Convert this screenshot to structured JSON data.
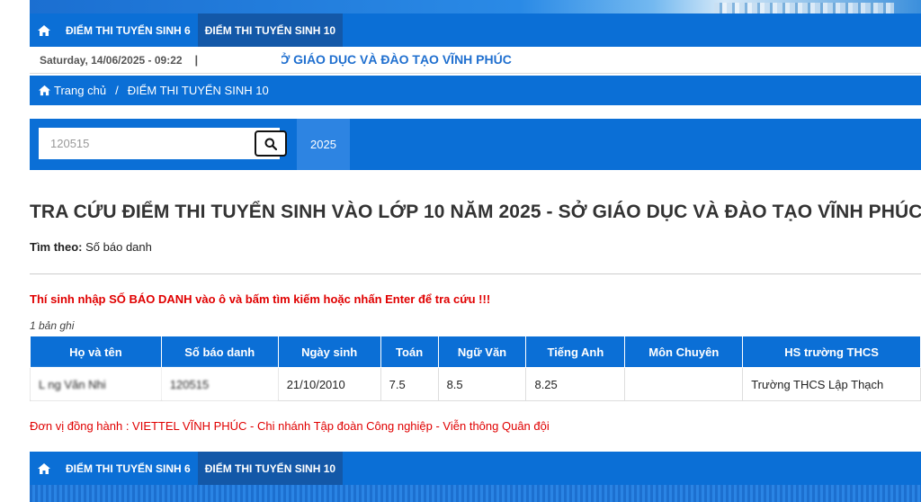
{
  "nav": {
    "home_icon": "home-icon",
    "items": [
      {
        "label": "ĐIỂM THI TUYỂN SINH 6"
      },
      {
        "label": "ĐIỂM THI TUYỂN SINH 10"
      }
    ]
  },
  "infobar": {
    "datetime": "Saturday, 14/06/2025 - 09:22",
    "separator": "|",
    "marquee": "SỞ GIÁO DỤC VÀ ĐÀO TẠO VĨNH PHÚC"
  },
  "breadcrumb": {
    "home_label": "Trang chủ",
    "separator": "/",
    "current": "ĐIỂM THI TUYỂN SINH 10"
  },
  "search": {
    "value": "120515",
    "button_icon": "search-icon",
    "year_tab": "2025"
  },
  "main": {
    "title": "TRA CỨU ĐIỂM THI TUYỂN SINH VÀO LỚP 10 NĂM 2025 - SỞ GIÁO DỤC VÀ ĐÀO TẠO VĨNH PHÚC",
    "search_by_label": "Tìm theo:",
    "search_by_value": "Số báo danh",
    "instruction": "Thí sinh nhập SỐ BÁO DANH vào ô và bấm tìm kiếm hoặc nhấn Enter để tra cứu !!!",
    "record_count": "1 bản ghi"
  },
  "table": {
    "headers": [
      "Họ và tên",
      "Số báo danh",
      "Ngày sinh",
      "Toán",
      "Ngữ Văn",
      "Tiếng Anh",
      "Môn Chuyên",
      "HS trường THCS"
    ],
    "rows": [
      {
        "name": "L     ng Văn Nhi",
        "sbd": "120515",
        "dob": "21/10/2010",
        "toan": "7.5",
        "van": "8.5",
        "anh": "8.25",
        "chuyen": "",
        "school": "Trường THCS Lập Thạch"
      }
    ]
  },
  "footer": {
    "sponsor": "Đơn vị đồng hành : VIETTEL VĨNH PHÚC - Chi nhánh Tập đoàn Công nghiệp - Viễn thông Quân đội"
  },
  "colors": {
    "primary": "#0b6fd6",
    "active": "#1358a8",
    "alert": "#e00000"
  }
}
